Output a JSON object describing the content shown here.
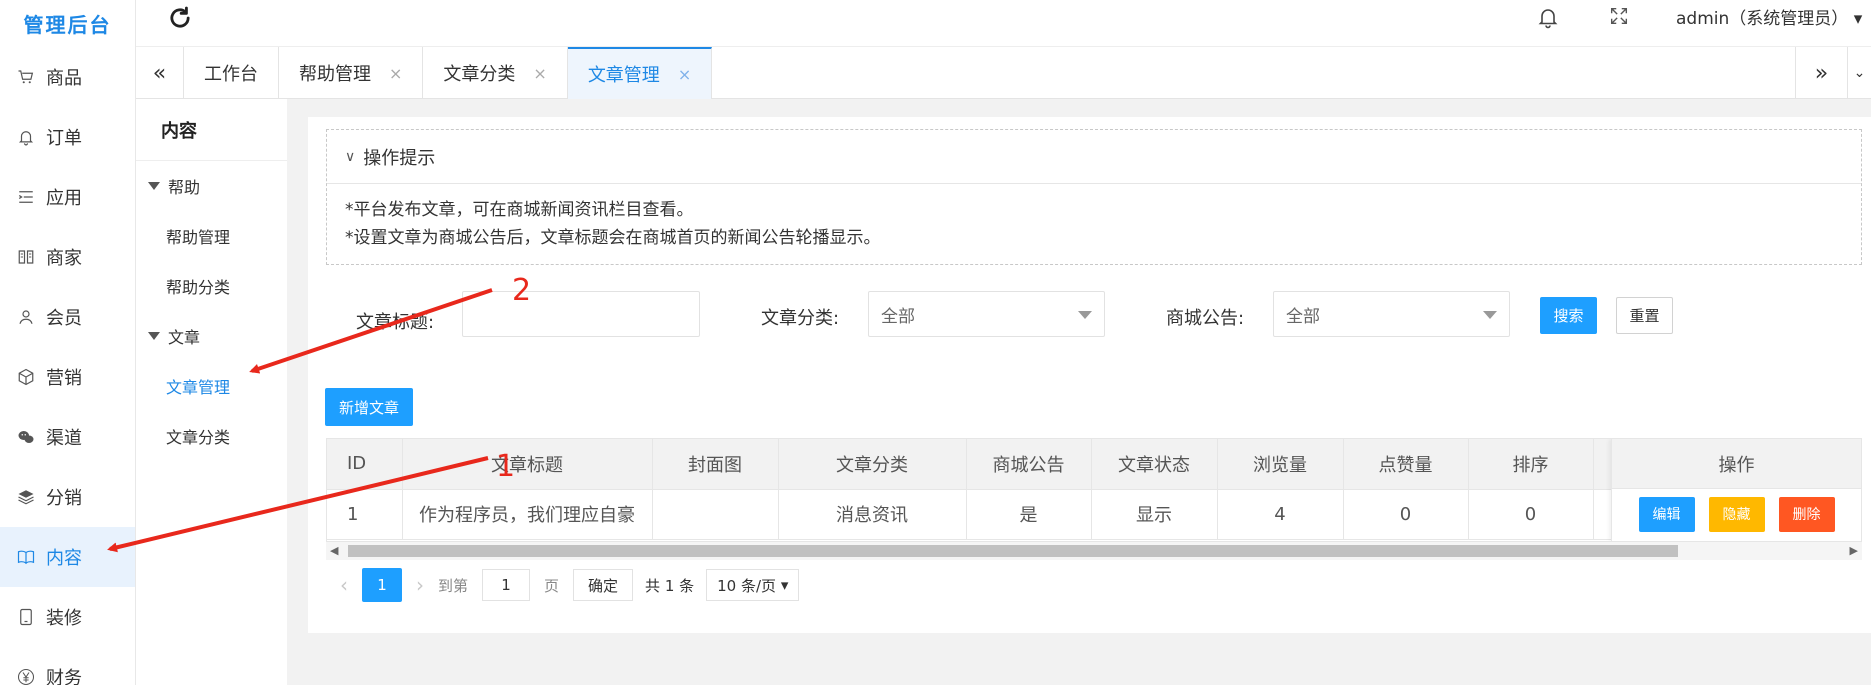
{
  "brand": "管理后台",
  "left_nav": [
    {
      "label": "商品",
      "icon": "cart-icon"
    },
    {
      "label": "订单",
      "icon": "bell-icon"
    },
    {
      "label": "应用",
      "icon": "list-icon"
    },
    {
      "label": "商家",
      "icon": "store-icon"
    },
    {
      "label": "会员",
      "icon": "user-icon"
    },
    {
      "label": "营销",
      "icon": "cube-icon"
    },
    {
      "label": "渠道",
      "icon": "wechat-icon"
    },
    {
      "label": "分销",
      "icon": "layers-icon"
    },
    {
      "label": "内容",
      "icon": "book-icon",
      "active": true
    },
    {
      "label": "装修",
      "icon": "tablet-icon"
    },
    {
      "label": "财务",
      "icon": "yen-icon"
    }
  ],
  "topbar": {
    "user": "admin（系统管理员）"
  },
  "tabs": [
    {
      "label": "工作台"
    },
    {
      "label": "帮助管理"
    },
    {
      "label": "文章分类"
    },
    {
      "label": "文章管理",
      "active": true
    }
  ],
  "sub_nav": {
    "title": "内容",
    "groups": [
      {
        "label": "帮助",
        "items": [
          "帮助管理",
          "帮助分类"
        ]
      },
      {
        "label": "文章",
        "items": [
          "文章管理",
          "文章分类"
        ]
      }
    ],
    "active_item": "文章管理"
  },
  "tips": {
    "title": "操作提示",
    "lines": [
      "*平台发布文章，可在商城新闻资讯栏目查看。",
      "*设置文章为商城公告后，文章标题会在商城首页的新闻公告轮播显示。"
    ]
  },
  "filters": {
    "title_label": "文章标题:",
    "title_value": "",
    "category_label": "文章分类:",
    "category_value": "全部",
    "notice_label": "商城公告:",
    "notice_value": "全部",
    "search_btn": "搜索",
    "reset_btn": "重置"
  },
  "add_btn": "新增文章",
  "table": {
    "columns": [
      "ID",
      "文章标题",
      "封面图",
      "文章分类",
      "商城公告",
      "文章状态",
      "浏览量",
      "点赞量",
      "排序"
    ],
    "ops_header": "操作",
    "rows": [
      {
        "cells": [
          "1",
          "作为程序员，我们理应自豪",
          "",
          "消息资讯",
          "是",
          "显示",
          "4",
          "0",
          "0"
        ]
      }
    ],
    "ops": [
      {
        "label": "编辑",
        "color": "#1e9fff"
      },
      {
        "label": "隐藏",
        "color": "#ffb800"
      },
      {
        "label": "删除",
        "color": "#ff5722"
      }
    ]
  },
  "pager": {
    "current": "1",
    "goto_label": "到第",
    "goto_value": "1",
    "page_unit": "页",
    "confirm": "确定",
    "total": "共 1 条",
    "size": "10 条/页"
  },
  "annotations": [
    "1",
    "2"
  ],
  "colors": {
    "accent": "#1e88e5",
    "primary_button": "#1e9fff",
    "annotation": "#e8281c"
  }
}
